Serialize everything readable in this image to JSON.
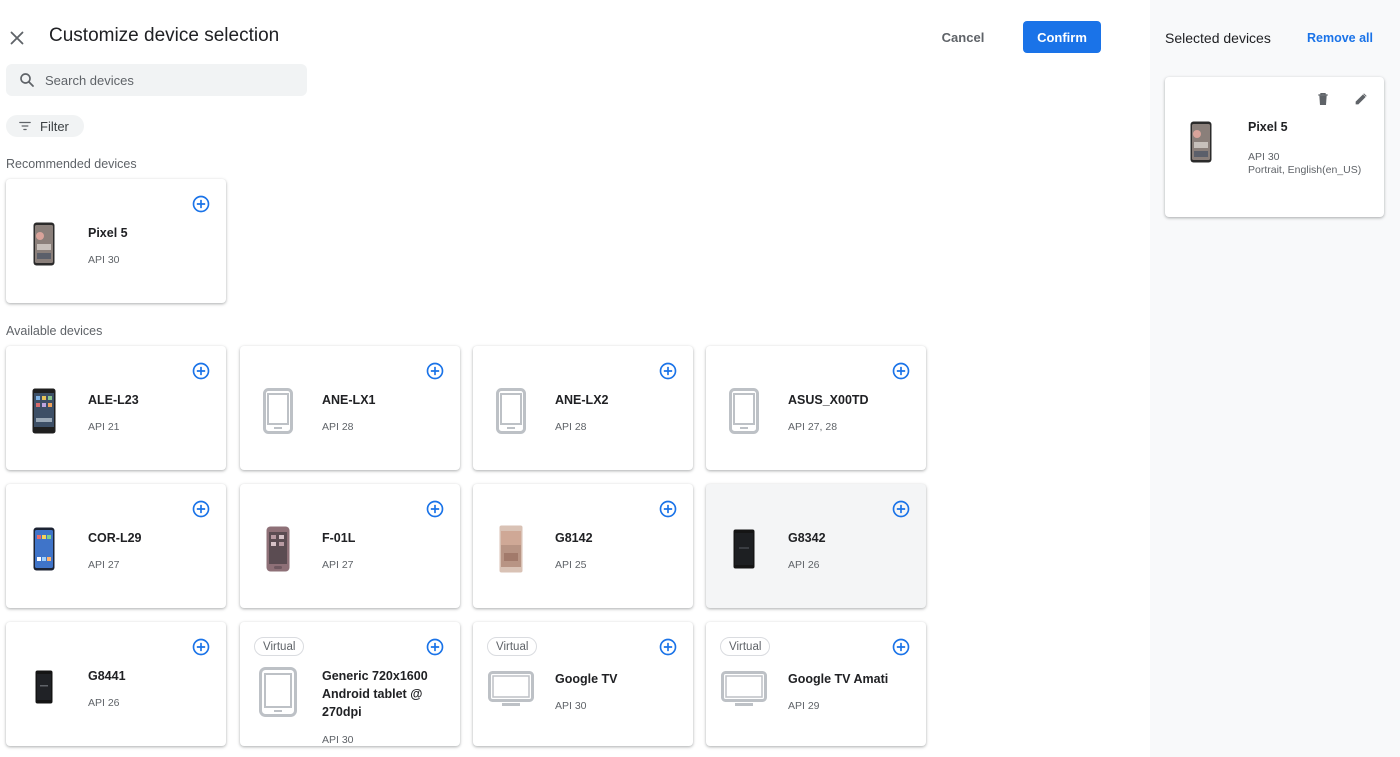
{
  "header": {
    "title": "Customize device selection",
    "cancel_label": "Cancel",
    "confirm_label": "Confirm",
    "close_icon": "close-icon"
  },
  "search": {
    "placeholder": "Search devices",
    "icon": "search-icon"
  },
  "filter": {
    "label": "Filter",
    "icon": "filter-list-icon"
  },
  "recommended": {
    "label": "Recommended devices",
    "devices": [
      {
        "name": "Pixel 5",
        "api": "API 30"
      }
    ]
  },
  "available": {
    "label": "Available devices",
    "devices": [
      {
        "name": "ALE-L23",
        "api": "API 21"
      },
      {
        "name": "ANE-LX1",
        "api": "API 28"
      },
      {
        "name": "ANE-LX2",
        "api": "API 28"
      },
      {
        "name": "ASUS_X00TD",
        "api": "API 27, 28"
      },
      {
        "name": "COR-L29",
        "api": "API 27"
      },
      {
        "name": "F-01L",
        "api": "API 27"
      },
      {
        "name": "G8142",
        "api": "API 25"
      },
      {
        "name": "G8342",
        "api": "API 26"
      },
      {
        "name": "G8441",
        "api": "API 26"
      },
      {
        "name": "Generic 720x1600 Android tablet @ 270dpi",
        "api": "API 30",
        "virtual": "Virtual"
      },
      {
        "name": "Google TV",
        "api": "API 30",
        "virtual": "Virtual"
      },
      {
        "name": "Google TV Amati",
        "api": "API 29",
        "virtual": "Virtual"
      }
    ]
  },
  "selected": {
    "title": "Selected devices",
    "remove_all_label": "Remove all",
    "devices": [
      {
        "name": "Pixel 5",
        "api": "API 30",
        "orientation_locale": "Portrait, English(en_US)"
      }
    ]
  },
  "colors": {
    "accent": "#1a73e8",
    "panel_bg": "#f8f9fa",
    "chip_bg": "#f1f3f4"
  }
}
